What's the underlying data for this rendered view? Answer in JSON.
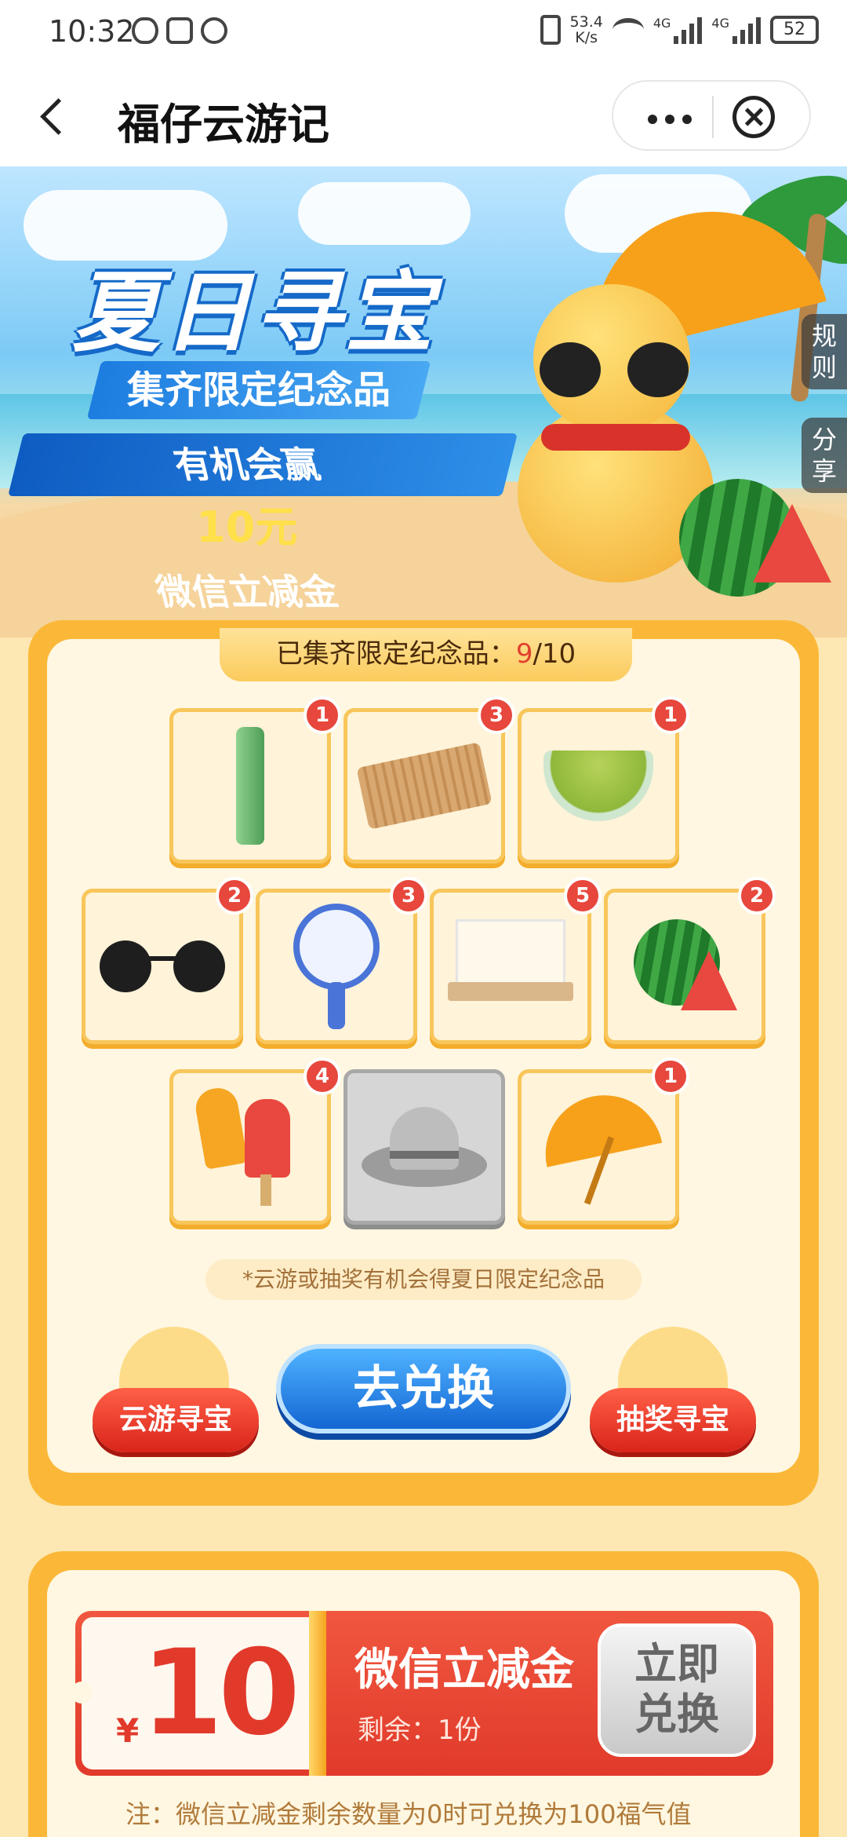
{
  "status_bar": {
    "time": "10:32",
    "speed_value": "53.4",
    "speed_unit": "K/s",
    "net1": "4G",
    "net2": "4G",
    "battery": "52"
  },
  "nav": {
    "title": "福仔云游记"
  },
  "banner": {
    "title": "夏日寻宝",
    "subtitle": "集齐限定纪念品",
    "promo_prefix": "有机会赢",
    "promo_amount": "10元",
    "promo_suffix": "微信立减金",
    "side_rules": "规则",
    "side_share": "分享"
  },
  "collection": {
    "counter_label": "已集齐限定纪念品：",
    "counter_have": "9",
    "counter_sep": "/",
    "counter_total": "10",
    "items": [
      {
        "name": "bottle",
        "count": "1"
      },
      {
        "name": "bamboo-mat",
        "count": "3"
      },
      {
        "name": "mung-bean-soup",
        "count": "1"
      },
      {
        "name": "sunglasses",
        "count": "2"
      },
      {
        "name": "fan",
        "count": "3"
      },
      {
        "name": "mosquito-net-bed",
        "count": "5"
      },
      {
        "name": "watermelon",
        "count": "2"
      },
      {
        "name": "popsicle",
        "count": "4"
      },
      {
        "name": "sun-hat",
        "count": ""
      },
      {
        "name": "umbrella",
        "count": "1"
      }
    ],
    "tip": "*云游或抽奖有机会得夏日限定纪念品",
    "left_button": "云游寻宝",
    "redeem_button": "去兑换",
    "right_button": "抽奖寻宝"
  },
  "voucher": {
    "currency": "¥",
    "amount": "10",
    "title": "微信立减金",
    "remaining": "剩余：1份",
    "button_line1": "立即",
    "button_line2": "兑换",
    "note": "注：微信立减金剩余数量为0时可兑换为100福气值"
  },
  "colors": {
    "accent_orange": "#fbb838",
    "accent_red": "#e13a2b",
    "accent_blue": "#1466d3"
  }
}
